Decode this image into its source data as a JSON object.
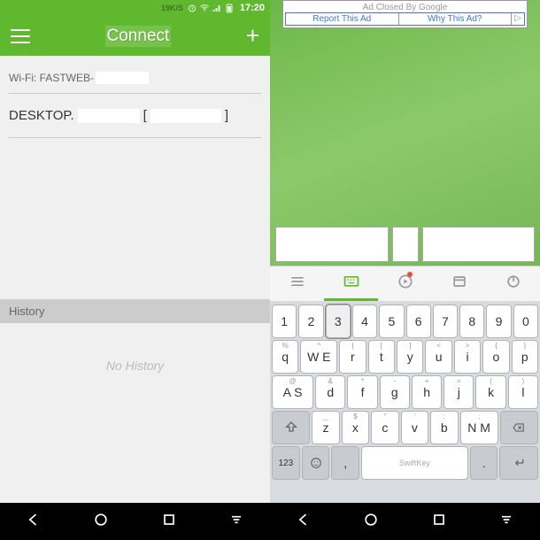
{
  "status": {
    "speed": "19K/S",
    "time": "17:20"
  },
  "appbar": {
    "title": "Connect"
  },
  "wifi": {
    "label": "Wi-Fi: FASTWEB-"
  },
  "device": {
    "name": "DESKTOP.",
    "bracket_open": "[",
    "bracket_close": "]"
  },
  "history": {
    "header": "History",
    "empty": "No History"
  },
  "ad": {
    "closed": "Ad Closed By Google",
    "report": "Report This Ad",
    "why": "Why This Ad?",
    "arrow": "▷"
  },
  "keys": {
    "row1": [
      "1",
      "2",
      "3",
      "4",
      "5",
      "6",
      "7",
      "8",
      "9",
      "0"
    ],
    "row2": {
      "main": [
        "q",
        "W E",
        "r",
        "t",
        "y",
        "u",
        "i",
        "o",
        "p"
      ],
      "sec": [
        "%",
        "^",
        "~",
        "|",
        "[",
        "]",
        "<",
        ">",
        "{",
        "}"
      ]
    },
    "row3": {
      "main": [
        "A S",
        "d",
        "f",
        "g",
        "h",
        "j",
        "k",
        "l"
      ],
      "sec": [
        "@",
        "#",
        "&",
        "*",
        "-",
        "+",
        "=",
        "(",
        ")"
      ]
    },
    "row4": {
      "main": [
        "z",
        "x",
        "c",
        "v",
        "b",
        "N M"
      ],
      "sec": [
        "_",
        "$",
        "\"",
        "'",
        ":",
        ";",
        "!",
        "?"
      ]
    },
    "n123": "123",
    "brand": "SwiftKey"
  }
}
